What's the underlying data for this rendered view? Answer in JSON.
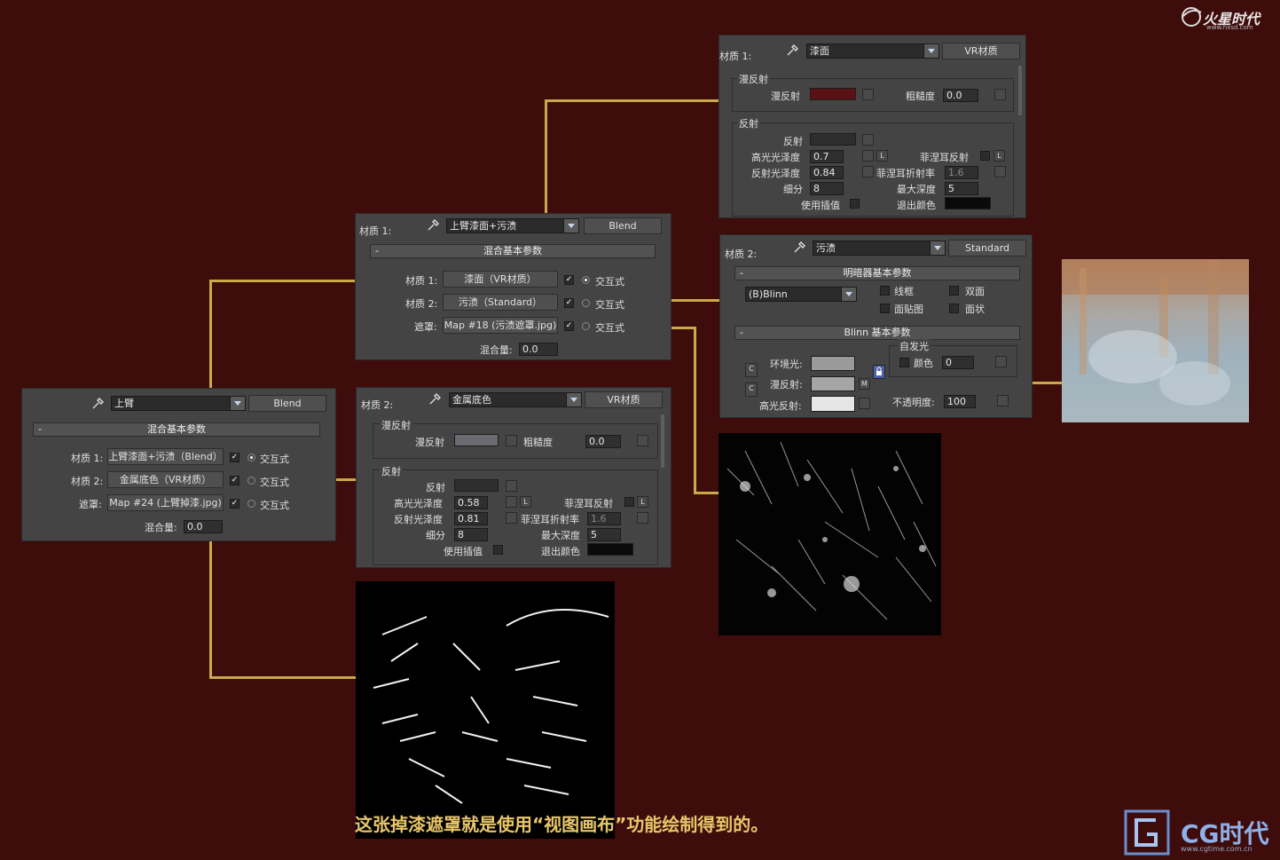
{
  "brand_top": {
    "logo": "火星时代",
    "url": "www.hxsd.com"
  },
  "brand_bottom": {
    "logo": "CG时代",
    "url": "www.cgtime.com.cn"
  },
  "caption": "这张掉漆遮罩就是使用“视图画布”功能绘制得到的。",
  "colors": {
    "background": "#3f0c0c",
    "panel": "#444444",
    "connector": "#c9a94a",
    "caption": "#e8c66a"
  },
  "icons": [
    "eyedropper-icon",
    "dropdown-arrow-icon",
    "map-button",
    "lock-icon"
  ],
  "panel_left": {
    "material_name": "上臂",
    "type_button": "Blend",
    "rollout": "混合基本参数",
    "rows": [
      {
        "label": "材质 1:",
        "map": "上臂漆面+污渍（Blend）",
        "radio": "交互式",
        "checked": true
      },
      {
        "label": "材质 2:",
        "map": "金属底色（VR材质）",
        "radio": "交互式",
        "checked": true
      },
      {
        "label": "遮罩:",
        "map": "Map #24 (上臂掉漆.jpg)",
        "radio": "交互式",
        "checked": true
      }
    ],
    "mix_label": "混合量:",
    "mix_value": "0.0"
  },
  "panel_blend2": {
    "mat_label": "材质 1:",
    "material_name": "上臂漆面+污渍",
    "type_button": "Blend",
    "rollout": "混合基本参数",
    "rows": [
      {
        "label": "材质 1:",
        "map": "漆面（VR材质）",
        "radio": "交互式",
        "checked": true
      },
      {
        "label": "材质 2:",
        "map": "污渍（Standard）",
        "radio": "交互式",
        "checked": true
      },
      {
        "label": "遮罩:",
        "map": "Map #18 (污渍遮罩.jpg)",
        "radio": "交互式",
        "checked": true
      }
    ],
    "mix_label": "混合量:",
    "mix_value": "0.0"
  },
  "panel_metal": {
    "mat_label": "材质 2:",
    "material_name": "金属底色",
    "type_button": "VR材质",
    "diffuse_group": "漫反射",
    "diffuse_label": "漫反射",
    "roughness_label": "粗糙度",
    "roughness": "0.0",
    "reflect_group": "反射",
    "reflect_label": "反射",
    "hilight_gloss_label": "高光光泽度",
    "hilight_gloss": "0.58",
    "fresnel_label": "菲涅耳反射",
    "refl_gloss_label": "反射光泽度",
    "refl_gloss": "0.81",
    "fresnel_ior_label": "菲涅耳折射率",
    "fresnel_ior": "1.6",
    "subdivs_label": "细分",
    "subdivs": "8",
    "max_depth_label": "最大深度",
    "max_depth": "5",
    "interp_label": "使用插值",
    "exit_color_label": "退出颜色",
    "l_label": "L",
    "diffuse_color": "#6a6c72",
    "reflect_color": "#2e2e2e",
    "exit_color": "#0a0a0a"
  },
  "panel_paint": {
    "mat_label": "材质 1:",
    "material_name": "漆面",
    "type_button": "VR材质",
    "diffuse_group": "漫反射",
    "diffuse_label": "漫反射",
    "roughness_label": "粗糙度",
    "roughness": "0.0",
    "reflect_group": "反射",
    "reflect_label": "反射",
    "hilight_gloss_label": "高光光泽度",
    "hilight_gloss": "0.7",
    "fresnel_label": "菲涅耳反射",
    "refl_gloss_label": "反射光泽度",
    "refl_gloss": "0.84",
    "fresnel_ior_label": "菲涅耳折射率",
    "fresnel_ior": "1.6",
    "subdivs_label": "细分",
    "subdivs": "8",
    "max_depth_label": "最大深度",
    "max_depth": "5",
    "interp_label": "使用插值",
    "exit_color_label": "退出颜色",
    "l_label": "L",
    "diffuse_color": "#5a1116",
    "reflect_color": "#2e2e2e",
    "exit_color": "#0a0a0a"
  },
  "panel_dirt": {
    "mat_label": "材质 2:",
    "material_name": "污渍",
    "type_button": "Standard",
    "shader_rollout": "明暗器基本参数",
    "shader": "(B)Blinn",
    "wire": "线框",
    "two_sided": "双面",
    "face_map": "面贴图",
    "faceted": "面状",
    "blinn_rollout": "Blinn 基本参数",
    "self_illum": "自发光",
    "color_label": "颜色",
    "self_illum_value": "0",
    "ambient_label": "环境光:",
    "diffuse_label": "漫反射:",
    "specular_label": "高光反射:",
    "opacity_label": "不透明度:",
    "opacity_value": "100",
    "c_label": "C",
    "m_label": "M",
    "ambient_color": "#9a9a9a",
    "diffuse_color": "#a6a6a6",
    "specular_color": "#e6e6e6"
  }
}
